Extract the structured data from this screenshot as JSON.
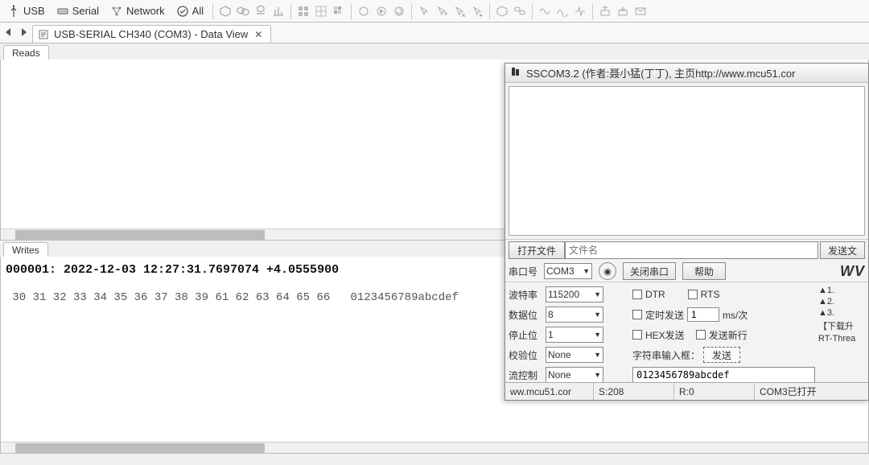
{
  "toolbar": {
    "usb": "USB",
    "serial": "Serial",
    "network": "Network",
    "all": "All"
  },
  "doc_tab": {
    "title": "USB-SERIAL CH340 (COM3) - Data View"
  },
  "sub_tabs": {
    "reads": "Reads",
    "writes": "Writes"
  },
  "writes": {
    "header": "000001: 2022-12-03 12:27:31.7697074 +4.0555900",
    "bytes": " 30 31 32 33 34 35 36 37 38 39 61 62 63 64 65 66   0123456789abcdef"
  },
  "sscom": {
    "title": "SSCOM3.2 (作者:聂小猛(丁丁), 主页http://www.mcu51.cor",
    "open_file_btn": "打开文件",
    "filename_placeholder": "文件名",
    "send_file_btn": "发送文",
    "port_label": "串口号",
    "port_value": "COM3",
    "close_port_btn": "关闭串口",
    "help_btn": "帮助",
    "ww": "WV",
    "params": {
      "baud_label": "波特率",
      "baud_value": "115200",
      "data_label": "数据位",
      "data_value": "8",
      "stop_label": "停止位",
      "stop_value": "1",
      "parity_label": "校验位",
      "parity_value": "None",
      "flow_label": "流控制",
      "flow_value": "None"
    },
    "opts": {
      "dtr": "DTR",
      "rts": "RTS",
      "timed_send": "定时发送",
      "interval_value": "1",
      "interval_unit": "ms/次",
      "hex_send": "HEX发送",
      "send_newline": "发送新行",
      "input_label": "字符串输入框：",
      "send_btn": "发送"
    },
    "side": {
      "a1": "▲1.",
      "a2": "▲2.",
      "a3": "▲3.",
      "dl": "【下载升",
      "rt": "RT-Threa"
    },
    "send_value": "0123456789abcdef",
    "status": {
      "url": "ww.mcu51.cor",
      "s": "S:208",
      "r": "R:0",
      "com": "COM3已打开"
    }
  }
}
